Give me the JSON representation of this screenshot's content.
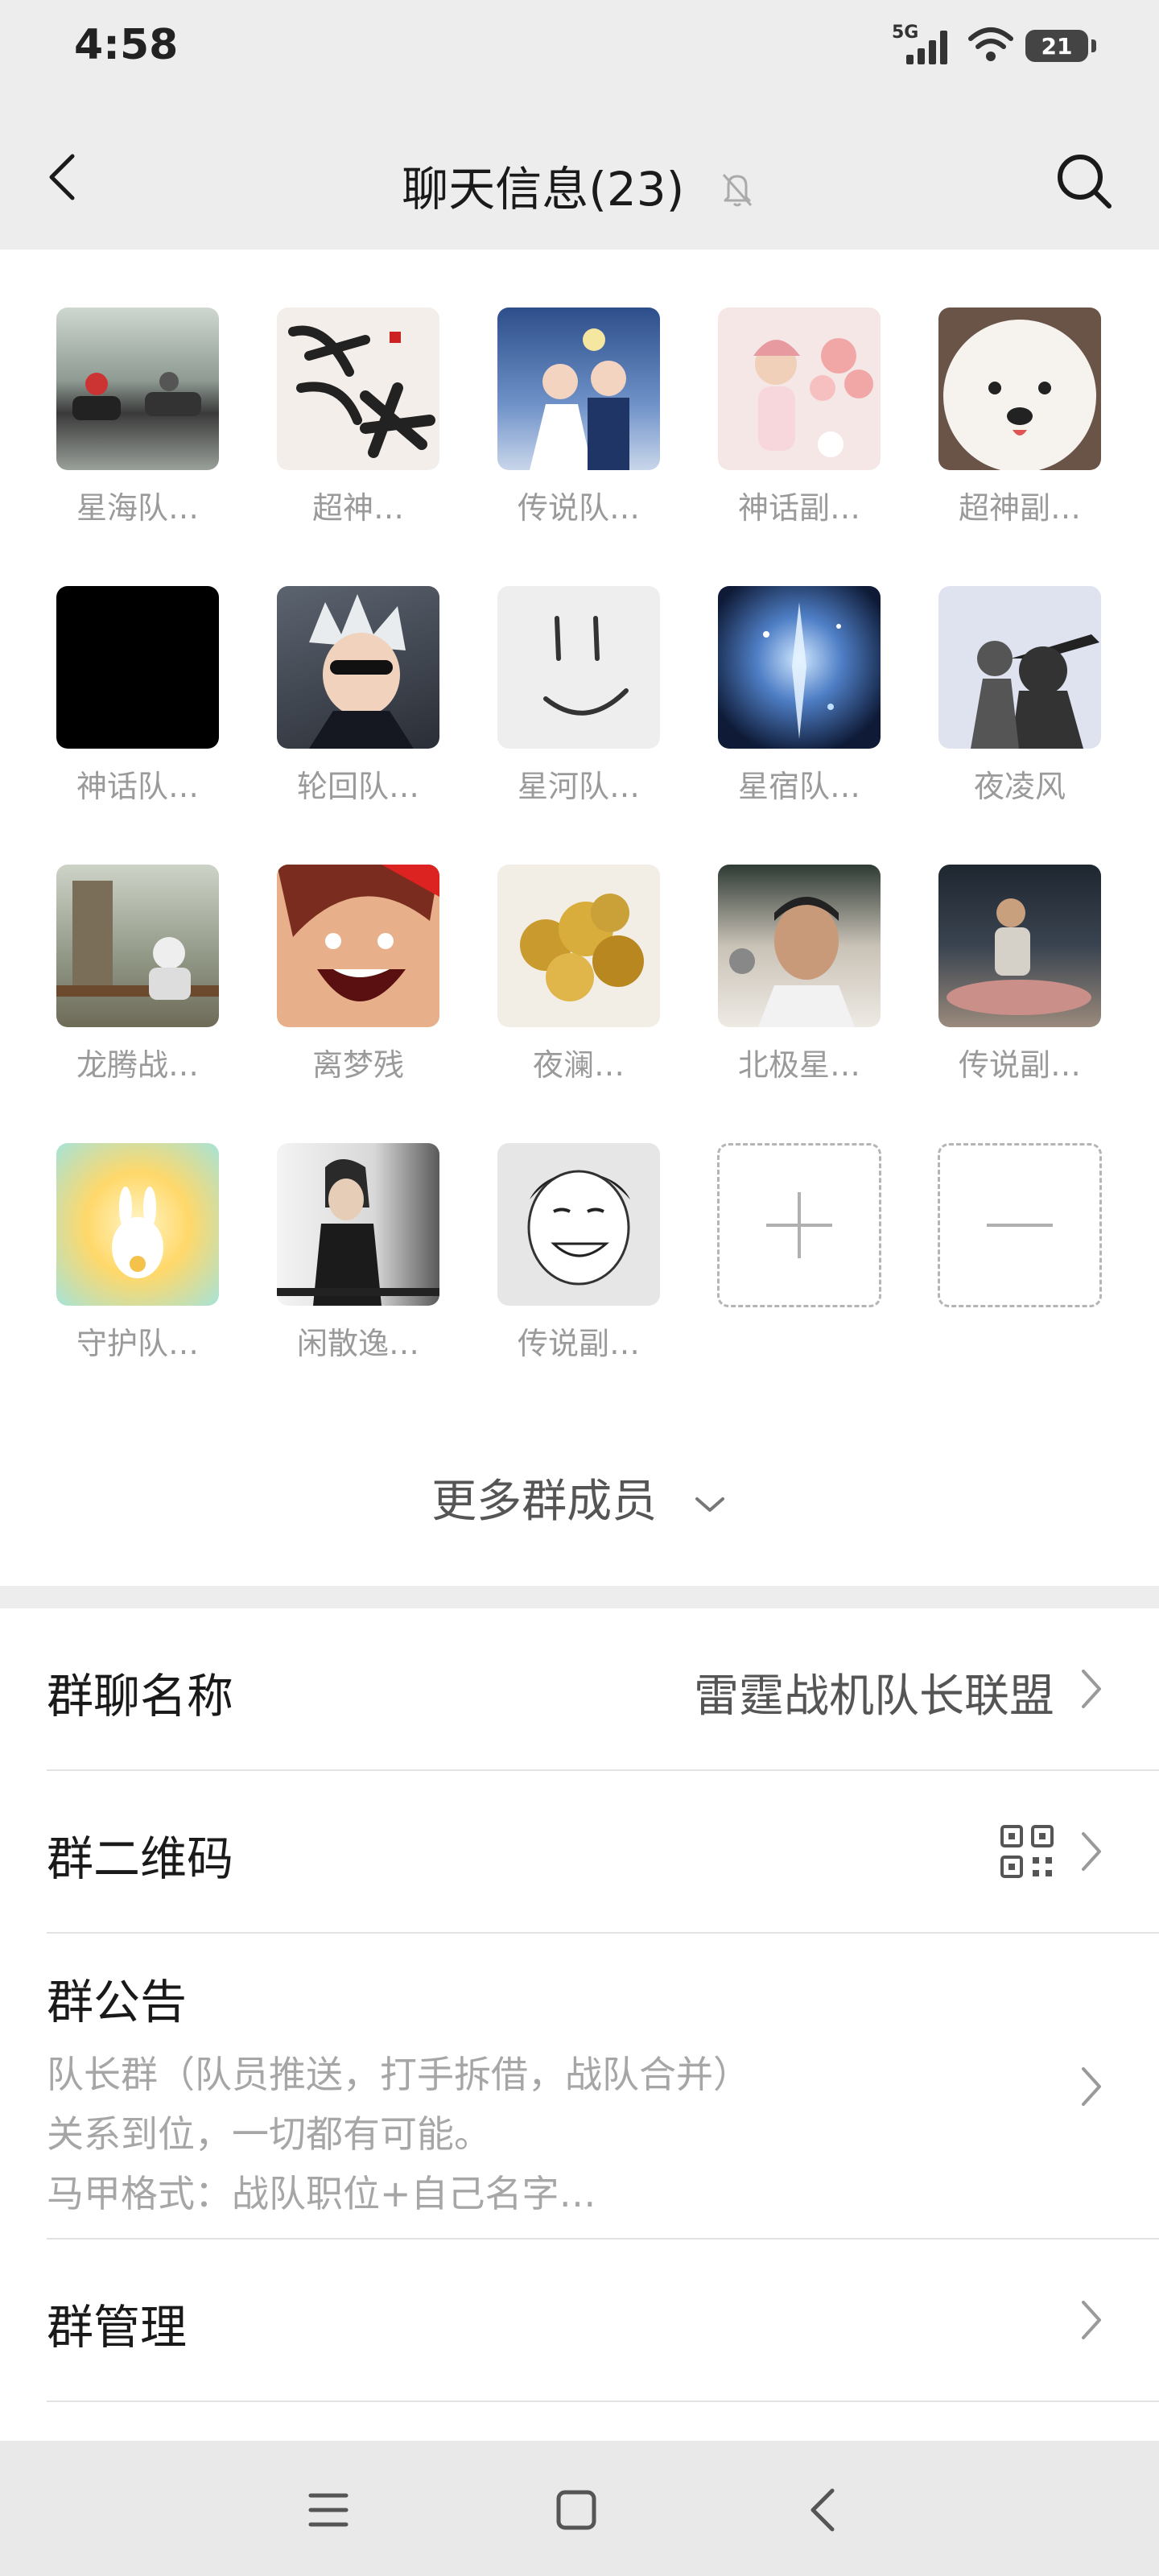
{
  "status_bar": {
    "time": "4:58",
    "network": "5G",
    "battery": "21"
  },
  "header": {
    "title": "聊天信息(23)"
  },
  "members": [
    {
      "name": "星海队…",
      "avatar": "go-kart-photo"
    },
    {
      "name": "超神…",
      "avatar": "calligraphy-art"
    },
    {
      "name": "传说队…",
      "avatar": "cartoon-wedding"
    },
    {
      "name": "神话副…",
      "avatar": "cartoon-girl-flowers"
    },
    {
      "name": "超神副…",
      "avatar": "white-dog"
    },
    {
      "name": "神话队…",
      "avatar": "black-square"
    },
    {
      "name": "轮回队…",
      "avatar": "anime-white-hair"
    },
    {
      "name": "星河队…",
      "avatar": "smiley-face"
    },
    {
      "name": "星宿队…",
      "avatar": "blue-fantasy"
    },
    {
      "name": "夜凌风",
      "avatar": "silhouette-hat"
    },
    {
      "name": "龙腾战…",
      "avatar": "bench-photo"
    },
    {
      "name": "离梦残",
      "avatar": "anime-laughing"
    },
    {
      "name": "夜澜…",
      "avatar": "gold-coins"
    },
    {
      "name": "北极星…",
      "avatar": "man-selfie"
    },
    {
      "name": "传说副…",
      "avatar": "night-car-photo"
    },
    {
      "name": "守护队…",
      "avatar": "cartoon-bunny"
    },
    {
      "name": "闲散逸…",
      "avatar": "game-character"
    },
    {
      "name": "传说副…",
      "avatar": "smiling-man-drawing"
    }
  ],
  "more_members": "更多群成员",
  "settings": {
    "group_name_label": "群聊名称",
    "group_name_value": "雷霆战机队长联盟",
    "qr_label": "群二维码",
    "notice_label": "群公告",
    "notice_lines": [
      "队长群（队员推送，打手拆借，战队合并）",
      "关系到位，一切都有可能。",
      "马甲格式：战队职位+自己名字…"
    ],
    "manage_label": "群管理"
  },
  "icons": {
    "back": "chevron-left-icon",
    "mute": "bell-off-icon",
    "search": "search-icon",
    "qr": "qr-code-icon",
    "add": "plus-icon",
    "remove": "minus-icon",
    "nav_menu": "menu-icon",
    "nav_home": "square-icon",
    "nav_back": "back-triangle-icon"
  }
}
